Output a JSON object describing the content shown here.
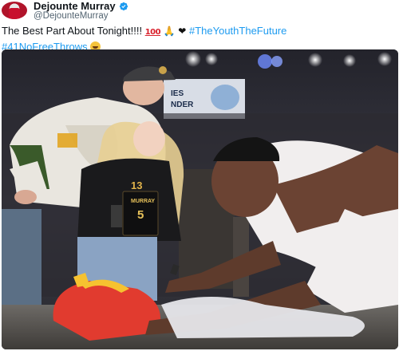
{
  "author": {
    "display_name": "Dejounte Murray",
    "handle": "@DejounteMurray",
    "avatar_icon": "profile-avatar-icon",
    "verified_icon": "verified-badge-icon"
  },
  "tweet": {
    "text_main": "The Best Part About Tonight!!!!",
    "emoji_100": "100",
    "emoji_pray": "🙏",
    "emoji_heart": "❤",
    "hashtag_1": "#TheYouthTheFuture",
    "hashtag_2": "#41NoFreeThrows",
    "emoji_rofl": "rolling-on-floor-laughing-emoji"
  },
  "photo": {
    "jersey_number_girl": "13",
    "sign_name": "MURRAY",
    "sign_number": "5",
    "scoreboard_text": "IES\nNDER"
  },
  "colors": {
    "link": "#1d9bf0",
    "verified": "#1d9bf0",
    "muted": "#536471"
  }
}
